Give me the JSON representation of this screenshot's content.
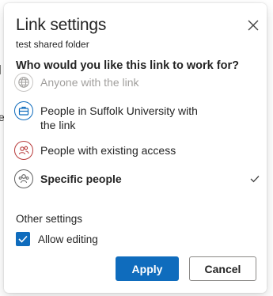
{
  "dialog": {
    "title": "Link settings",
    "subtitle": "test shared folder",
    "close_icon": "close-icon"
  },
  "question": "Who would you like this link to work for?",
  "options": [
    {
      "label": "Anyone with the link",
      "icon": "globe-icon",
      "state": "disabled",
      "icon_color": "#a19f9d"
    },
    {
      "label": "People in Suffolk University with the link",
      "icon": "briefcase-icon",
      "state": "enabled",
      "icon_color": "#0f6cbd"
    },
    {
      "label": "People with existing access",
      "icon": "people-icon",
      "state": "enabled",
      "icon_color": "#b83a3a"
    },
    {
      "label": "Specific people",
      "icon": "person-group-icon",
      "state": "selected",
      "icon_color": "#616161",
      "selected_indicator": "checkmark-icon"
    }
  ],
  "other_settings": {
    "heading": "Other settings",
    "allow_editing": {
      "label": "Allow editing",
      "checked": true
    }
  },
  "buttons": {
    "apply": "Apply",
    "cancel": "Cancel"
  },
  "colors": {
    "accent": "#0f6cbd",
    "text": "#242424",
    "disabled": "#a19f9d",
    "existing_access": "#b83a3a"
  },
  "background_fragments": [
    "l",
    "e"
  ]
}
